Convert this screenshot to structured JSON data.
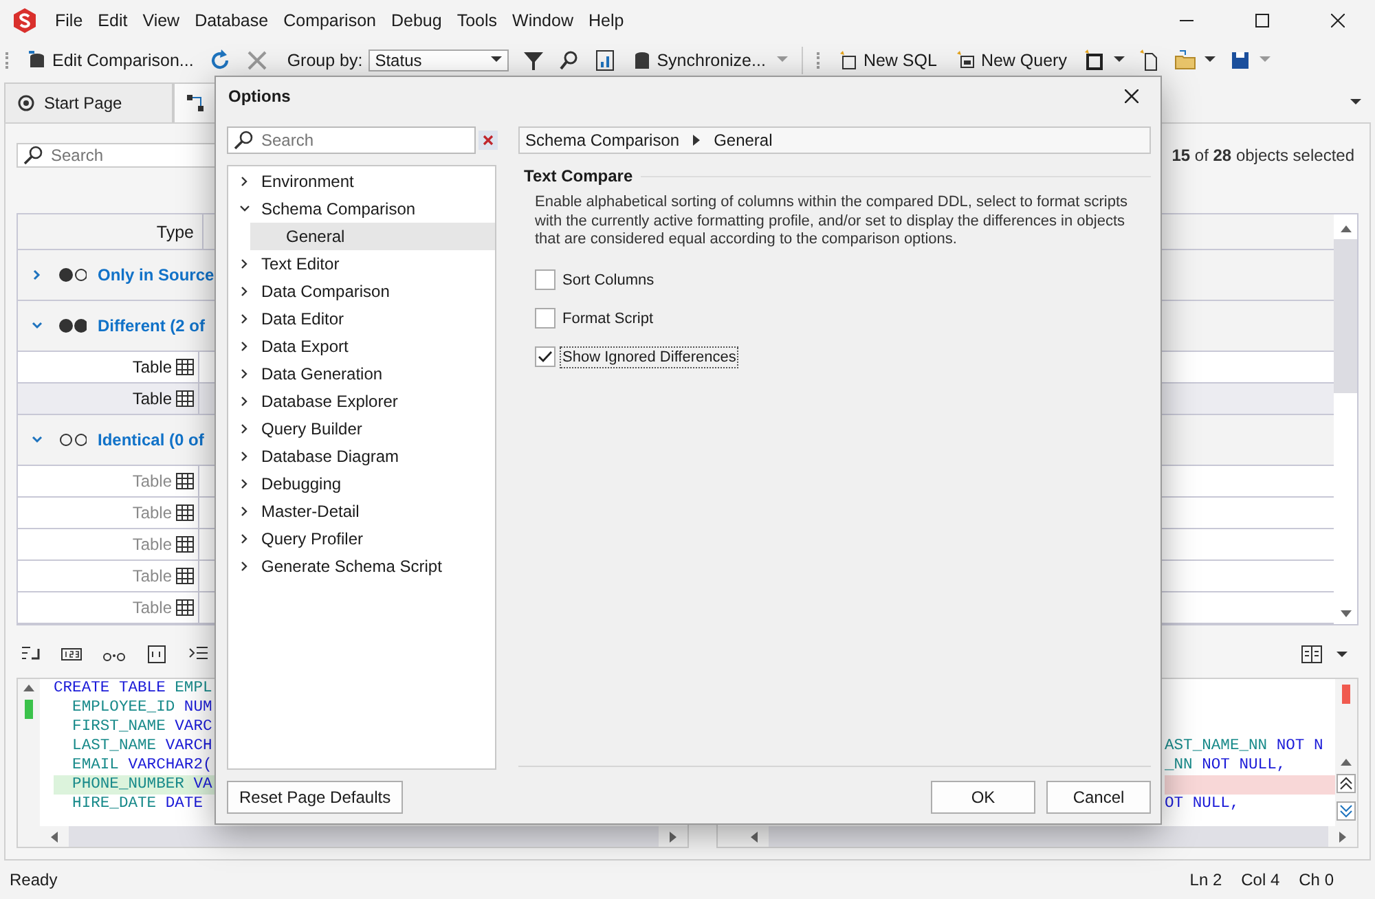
{
  "menu": [
    "File",
    "Edit",
    "View",
    "Database",
    "Comparison",
    "Debug",
    "Tools",
    "Window",
    "Help"
  ],
  "toolbar": {
    "edit": "Edit Comparison...",
    "group_by_label": "Group by:",
    "group_by_value": "Status",
    "synchronize": "Synchronize...",
    "new_sql": "New SQL",
    "new_query": "New Query"
  },
  "tabs": [
    {
      "label": "Start Page",
      "selected": false
    }
  ],
  "search": {
    "placeholder": "Search"
  },
  "selection_summary": "**15** of **28** objects selected",
  "grid": {
    "columns": [
      "Type"
    ],
    "groups": [
      {
        "kind": "source",
        "label": "Only in Source",
        "expanded": false
      },
      {
        "kind": "different",
        "label": "Different (2 of",
        "expanded": true,
        "rows": [
          {
            "type": "Table",
            "selected": false,
            "dimmed": false
          },
          {
            "type": "Table",
            "selected": true,
            "dimmed": false
          }
        ]
      },
      {
        "kind": "identical",
        "label": "Identical (0 of",
        "expanded": true,
        "rows": [
          {
            "type": "Table",
            "selected": false,
            "dimmed": true
          },
          {
            "type": "Table",
            "selected": false,
            "dimmed": true
          },
          {
            "type": "Table",
            "selected": false,
            "dimmed": true
          },
          {
            "type": "Table",
            "selected": false,
            "dimmed": true
          },
          {
            "type": "Table",
            "selected": false,
            "dimmed": true
          }
        ]
      }
    ]
  },
  "code": {
    "left": [
      {
        "changed": false,
        "parts": [
          {
            "text": "CREATE TABLE ",
            "kind": "keyword"
          },
          {
            "text": "EMPL",
            "kind": "name"
          }
        ]
      },
      {
        "changed": false,
        "parts": [
          {
            "text": "  EMPLOYEE_ID ",
            "kind": "name"
          },
          {
            "text": "NUM",
            "kind": "keyword"
          }
        ]
      },
      {
        "changed": false,
        "parts": [
          {
            "text": "  FIRST_NAME ",
            "kind": "name"
          },
          {
            "text": "VARC",
            "kind": "keyword"
          }
        ]
      },
      {
        "changed": false,
        "parts": [
          {
            "text": "  LAST_NAME ",
            "kind": "name"
          },
          {
            "text": "VARCH",
            "kind": "keyword"
          }
        ]
      },
      {
        "changed": false,
        "parts": [
          {
            "text": "  EMAIL ",
            "kind": "name"
          },
          {
            "text": "VARCHAR2(",
            "kind": "keyword"
          }
        ]
      },
      {
        "changed": true,
        "parts": [
          {
            "text": "  PHONE_NUMBER ",
            "kind": "name"
          },
          {
            "text": "VA",
            "kind": "keyword"
          }
        ]
      },
      {
        "changed": false,
        "parts": [
          {
            "text": "  HIRE_DATE ",
            "kind": "name"
          },
          {
            "text": "DATE",
            "kind": "keyword"
          }
        ]
      }
    ],
    "right": [
      {
        "changed": false,
        "parts": [
          {
            "text": "AST_NAME_NN ",
            "kind": "name"
          },
          {
            "text": "NOT N",
            "kind": "keyword"
          }
        ]
      },
      {
        "changed": false,
        "parts": [
          {
            "text": "_NN ",
            "kind": "name"
          },
          {
            "text": "NOT NULL,",
            "kind": "keyword"
          }
        ]
      },
      {
        "changed": true
      },
      {
        "changed": false,
        "parts": [
          {
            "text": "OT NULL,",
            "kind": "keyword"
          }
        ]
      }
    ]
  },
  "status_bar": {
    "state": "Ready",
    "line": "Ln 2",
    "column": "Col 4",
    "char": "Ch 0"
  },
  "dialog": {
    "title": "Options",
    "search": {
      "placeholder": "Search"
    },
    "tree": [
      {
        "label": "Environment",
        "expanded": false,
        "selected": false
      },
      {
        "label": "Schema Comparison",
        "expanded": true,
        "selected": false,
        "children": [
          {
            "label": "General",
            "selected": true
          }
        ]
      },
      {
        "label": "Text Editor",
        "expanded": false,
        "selected": false
      },
      {
        "label": "Data Comparison",
        "expanded": false,
        "selected": false
      },
      {
        "label": "Data Editor",
        "expanded": false,
        "selected": false
      },
      {
        "label": "Data Export",
        "expanded": false,
        "selected": false
      },
      {
        "label": "Data Generation",
        "expanded": false,
        "selected": false
      },
      {
        "label": "Database Explorer",
        "expanded": false,
        "selected": false
      },
      {
        "label": "Query Builder",
        "expanded": false,
        "selected": false
      },
      {
        "label": "Database Diagram",
        "expanded": false,
        "selected": false
      },
      {
        "label": "Debugging",
        "expanded": false,
        "selected": false
      },
      {
        "label": "Master-Detail",
        "expanded": false,
        "selected": false
      },
      {
        "label": "Query Profiler",
        "expanded": false,
        "selected": false
      },
      {
        "label": "Generate Schema Script",
        "expanded": false,
        "selected": false
      }
    ],
    "breadcrumb": [
      "Schema Comparison",
      "General"
    ],
    "section": "Text Compare",
    "description": "Enable alphabetical sorting of columns within the compared DDL, select to format scripts with the currently active formatting profile, and/or set to display the differences in objects that are considered equal according to the comparison options.",
    "options": [
      {
        "label": "Sort Columns",
        "checked": false,
        "focused": false
      },
      {
        "label": "Format Script",
        "checked": false,
        "focused": false
      },
      {
        "label": "Show Ignored Differences",
        "checked": true,
        "focused": true
      }
    ],
    "buttons": {
      "reset": "Reset Page Defaults",
      "ok": "OK",
      "cancel": "Cancel"
    }
  }
}
